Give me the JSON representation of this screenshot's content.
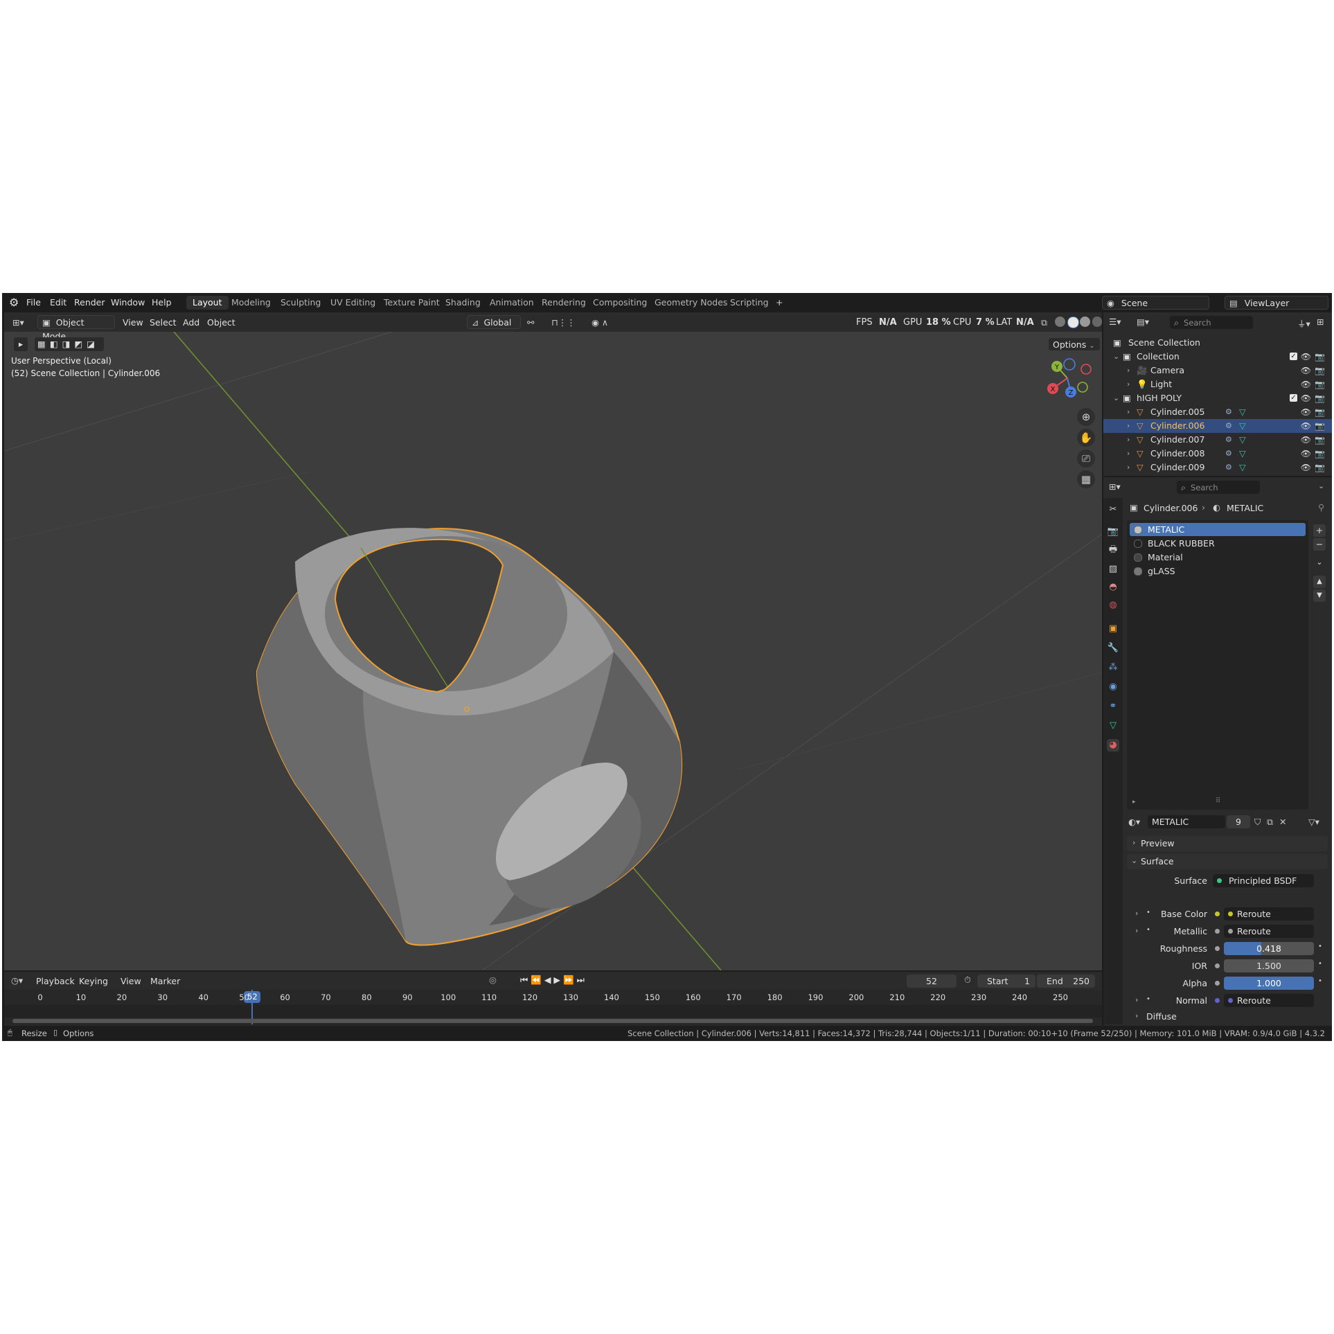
{
  "topbar": {
    "menus": [
      "File",
      "Edit",
      "Render",
      "Window",
      "Help"
    ],
    "workspaces": [
      "Layout",
      "Modeling",
      "Sculpting",
      "UV Editing",
      "Texture Paint",
      "Shading",
      "Animation",
      "Rendering",
      "Compositing",
      "Geometry Nodes",
      "Scripting"
    ],
    "add_workspace": "+",
    "scene_label": "Scene",
    "viewlayer_label": "ViewLayer"
  },
  "viewport": {
    "mode": "Object Mode",
    "menus": [
      "View",
      "Select",
      "Add",
      "Object"
    ],
    "transform_orientation": "Global",
    "options_label": "Options",
    "stats": {
      "fps_label": "FPS",
      "fps_value": "N/A",
      "gpu_label": "GPU",
      "gpu_value": "18 %",
      "cpu_label": "CPU",
      "cpu_value": "7 %",
      "lat_label": "LAT",
      "lat_value": "N/A"
    },
    "perspective_text": "User Perspective (Local)",
    "collection_text": "(52) Scene Collection | Cylinder.006",
    "gizmo": {
      "y": "Y",
      "x": "X",
      "z": "Z"
    }
  },
  "outliner": {
    "search_placeholder": "Search",
    "root": "Scene Collection",
    "rows": [
      {
        "name": "Collection",
        "indent": 1,
        "type": "collection"
      },
      {
        "name": "Camera",
        "indent": 2,
        "type": "camera"
      },
      {
        "name": "Light",
        "indent": 2,
        "type": "light"
      },
      {
        "name": "hIGH POLY",
        "indent": 1,
        "type": "collection"
      },
      {
        "name": "Cylinder.005",
        "indent": 2,
        "type": "mesh"
      },
      {
        "name": "Cylinder.006",
        "indent": 2,
        "type": "mesh",
        "selected": true
      },
      {
        "name": "Cylinder.007",
        "indent": 2,
        "type": "mesh"
      },
      {
        "name": "Cylinder.008",
        "indent": 2,
        "type": "mesh"
      },
      {
        "name": "Cylinder.009",
        "indent": 2,
        "type": "mesh"
      }
    ]
  },
  "properties": {
    "search_placeholder": "Search",
    "breadcrumb_object": "Cylinder.006",
    "breadcrumb_material": "METALIC",
    "materials": [
      "METALIC",
      "BLACK RUBBER",
      "Material",
      "gLASS"
    ],
    "active_material": "METALIC",
    "user_count": "9",
    "preview_label": "Preview",
    "surface_section": "Surface",
    "surface_label": "Surface",
    "surface_value": "Principled BSDF",
    "inputs": [
      {
        "label": "Base Color",
        "value": "Reroute",
        "kind": "link",
        "socket": "#c7c729"
      },
      {
        "label": "Metallic",
        "value": "Reroute",
        "kind": "link",
        "socket": "#a1a1a1"
      },
      {
        "label": "Roughness",
        "value": "0.418",
        "kind": "slider",
        "fill": 0.418
      },
      {
        "label": "IOR",
        "value": "1.500",
        "kind": "field"
      },
      {
        "label": "Alpha",
        "value": "1.000",
        "kind": "slider",
        "fill": 1.0
      },
      {
        "label": "Normal",
        "value": "Reroute",
        "kind": "link",
        "socket": "#6363c7"
      }
    ],
    "diffuse_label": "Diffuse"
  },
  "timeline": {
    "menus": [
      "Playback",
      "Keying",
      "View",
      "Marker"
    ],
    "current_frame": "52",
    "start_label": "Start",
    "start_value": "1",
    "end_label": "End",
    "end_value": "250",
    "ticks": [
      "0",
      "10",
      "20",
      "30",
      "40",
      "50",
      "60",
      "70",
      "80",
      "90",
      "100",
      "110",
      "120",
      "130",
      "140",
      "150",
      "160",
      "170",
      "180",
      "190",
      "200",
      "210",
      "220",
      "230",
      "240",
      "250"
    ]
  },
  "statusbar": {
    "left_items": [
      "Resize",
      "Options"
    ],
    "info": "Scene Collection | Cylinder.006 | Verts:14,811 | Faces:14,372 | Tris:28,744 | Objects:1/11 | Duration: 00:10+10 (Frame 52/250) | Memory: 101.0 MiB | VRAM: 0.9/4.0 GiB | 4.3.2"
  },
  "colors": {
    "accent": "#4772b3",
    "selection": "#f0a030",
    "active_text": "#f5c25b"
  }
}
